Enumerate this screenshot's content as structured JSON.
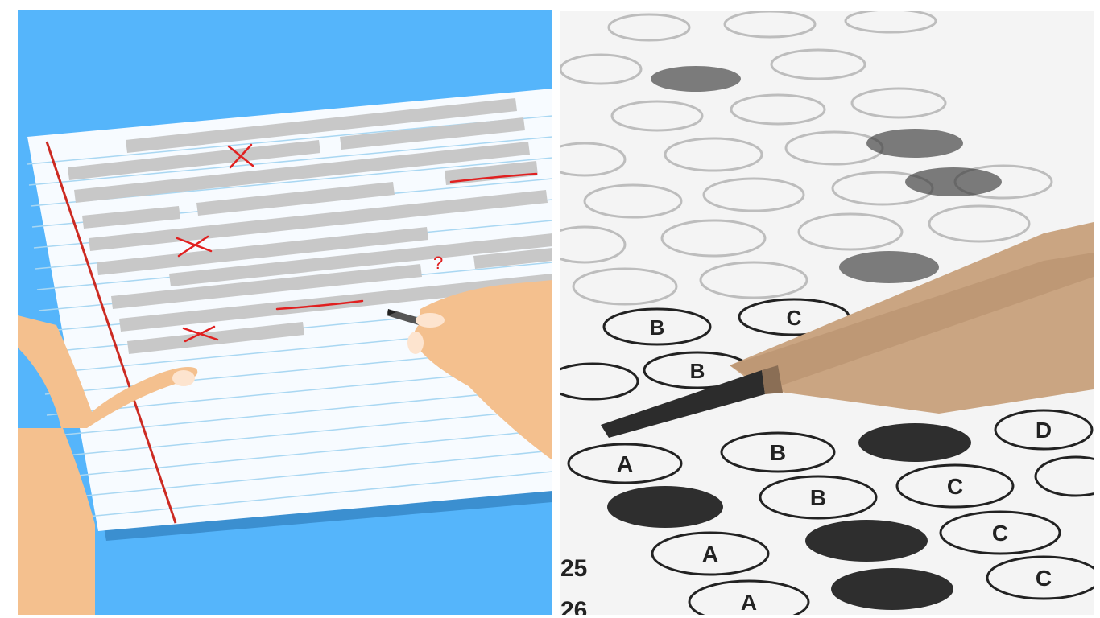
{
  "left_illustration": {
    "marks": {
      "question": "?"
    },
    "colors": {
      "background": "#55b5fb",
      "paper": "#f7fbff",
      "ruled_line": "#a9d7f2",
      "margin_line": "#cc2a22",
      "text_bar": "#c8c8c8",
      "correction": "#e02020",
      "skin": "#f4c08e"
    }
  },
  "right_photo": {
    "bubble_letters": {
      "a": "A",
      "b": "B",
      "c": "C",
      "d": "D"
    },
    "question_numbers": {
      "q25": "25",
      "q26": "26"
    },
    "colors": {
      "sheet": "#f4f4f4",
      "filled_bubble": "#3a3a3a",
      "pencil_wood": "#caa582",
      "pencil_lead": "#2c2c2c"
    }
  }
}
